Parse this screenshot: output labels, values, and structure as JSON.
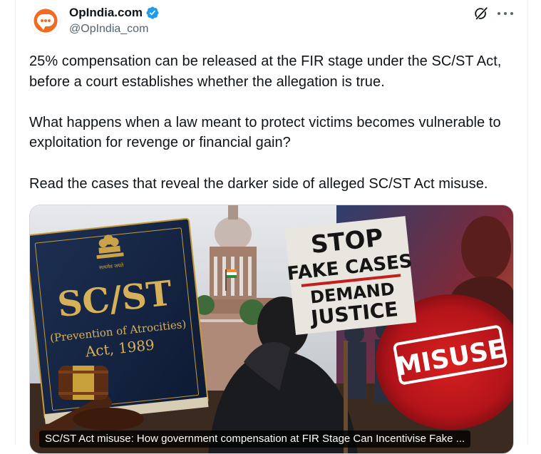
{
  "author": {
    "display_name": "OpIndia.com",
    "handle": "@OpIndia_com",
    "verified_icon": "verified-badge-icon",
    "avatar_icon": "opindia-logo-icon",
    "verified_color": "#1d9bf0",
    "brand_color": "#f36b20"
  },
  "actions": {
    "grok_icon": "grok-icon",
    "more_icon": "more-options-icon"
  },
  "tweet": {
    "paragraphs": [
      "25% compensation can be released at the FIR stage under the SC/ST Act, before a court establishes whether the allegation is true.",
      "What happens when a law meant to protect victims becomes vulnerable to exploitation for revenge or financial gain?",
      "Read the cases that reveal the darker side of alleged SC/ST Act misuse."
    ]
  },
  "media": {
    "caption": "SC/ST Act misuse: How government compensation at FIR Stage Can Incentivise Fake ...",
    "book": {
      "emblem_text": "सत्यमेव जयते",
      "title": "SC/ST",
      "subtitle": "(Prevention of Atrocities)",
      "year_line": "Act, 1989"
    },
    "placard": {
      "line1": "STOP",
      "line2": "FAKE CASES",
      "line3": "DEMAND",
      "line4": "JUSTICE"
    },
    "stamp": "MISUSE"
  }
}
